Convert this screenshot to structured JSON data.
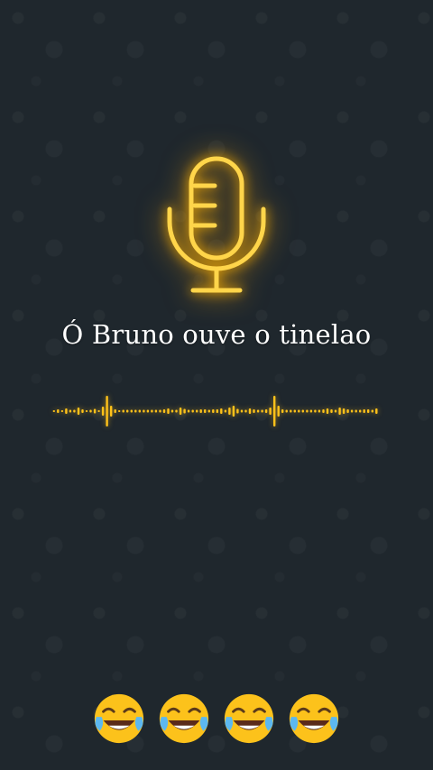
{
  "caption": "Ó Bruno ouve o tinelao",
  "icons": {
    "mic": "microphone-icon",
    "emoji": "face-with-tears-of-joy-icon"
  },
  "colors": {
    "background": "#1f272d",
    "neon": "#ffc21a",
    "text": "#ffffff"
  },
  "emoji_count": 4
}
